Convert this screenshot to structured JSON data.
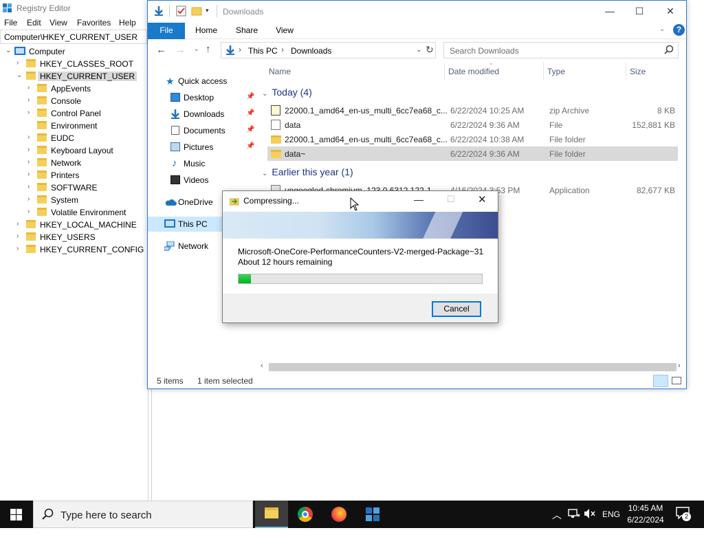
{
  "regedit": {
    "title": "Registry Editor",
    "menu": [
      "File",
      "Edit",
      "View",
      "Favorites",
      "Help"
    ],
    "address": "Computer\\HKEY_CURRENT_USER",
    "tree": [
      {
        "label": "Computer",
        "level": 0,
        "expanded": true,
        "icon": "pc-icon"
      },
      {
        "label": "HKEY_CLASSES_ROOT",
        "level": 1,
        "expanded": false
      },
      {
        "label": "HKEY_CURRENT_USER",
        "level": 1,
        "expanded": true,
        "selected": true
      },
      {
        "label": "AppEvents",
        "level": 2,
        "expanded": false
      },
      {
        "label": "Console",
        "level": 2,
        "expanded": false
      },
      {
        "label": "Control Panel",
        "level": 2,
        "expanded": false
      },
      {
        "label": "Environment",
        "level": 2,
        "leaf": true
      },
      {
        "label": "EUDC",
        "level": 2,
        "expanded": false
      },
      {
        "label": "Keyboard Layout",
        "level": 2,
        "expanded": false
      },
      {
        "label": "Network",
        "level": 2,
        "expanded": false
      },
      {
        "label": "Printers",
        "level": 2,
        "expanded": false
      },
      {
        "label": "SOFTWARE",
        "level": 2,
        "expanded": false
      },
      {
        "label": "System",
        "level": 2,
        "expanded": false
      },
      {
        "label": "Volatile Environment",
        "level": 2,
        "expanded": false
      },
      {
        "label": "HKEY_LOCAL_MACHINE",
        "level": 1,
        "expanded": false
      },
      {
        "label": "HKEY_USERS",
        "level": 1,
        "expanded": false
      },
      {
        "label": "HKEY_CURRENT_CONFIG",
        "level": 1,
        "expanded": false
      }
    ]
  },
  "explorer": {
    "title": "Downloads",
    "ribbon_tabs": [
      "File",
      "Home",
      "Share",
      "View"
    ],
    "breadcrumb": [
      "This PC",
      "Downloads"
    ],
    "search_placeholder": "Search Downloads",
    "nav": [
      {
        "label": "Quick access",
        "icon": "star-icon",
        "pinned": false
      },
      {
        "label": "Desktop",
        "icon": "desktop-icon",
        "pinned": true
      },
      {
        "label": "Downloads",
        "icon": "download-icon",
        "pinned": true
      },
      {
        "label": "Documents",
        "icon": "documents-icon",
        "pinned": true
      },
      {
        "label": "Pictures",
        "icon": "pictures-icon",
        "pinned": true
      },
      {
        "label": "Music",
        "icon": "music-icon",
        "pinned": false
      },
      {
        "label": "Videos",
        "icon": "videos-icon",
        "pinned": false
      },
      {
        "label": "OneDrive",
        "icon": "onedrive-icon",
        "pinned": false
      },
      {
        "label": "This PC",
        "icon": "pc-icon",
        "pinned": false,
        "selected": true
      },
      {
        "label": "Network",
        "icon": "network-icon",
        "pinned": false
      }
    ],
    "columns": [
      "Name",
      "Date modified",
      "Type",
      "Size"
    ],
    "groups": [
      {
        "label": "Today (4)",
        "files": [
          {
            "name": "22000.1_amd64_en-us_multi_6cc7ea68_c...",
            "date": "6/22/2024 10:25 AM",
            "type": "zip Archive",
            "size": "8 KB",
            "icon": "zip"
          },
          {
            "name": "data",
            "date": "6/22/2024 9:36 AM",
            "type": "File",
            "size": "152,881 KB",
            "icon": "doc"
          },
          {
            "name": "22000.1_amd64_en-us_multi_6cc7ea68_c...",
            "date": "6/22/2024 10:38 AM",
            "type": "File folder",
            "size": "",
            "icon": "folder"
          },
          {
            "name": "data~",
            "date": "6/22/2024 9:36 AM",
            "type": "File folder",
            "size": "",
            "icon": "folder",
            "selected": true
          }
        ]
      },
      {
        "label": "Earlier this year (1)",
        "files": [
          {
            "name": "ungoogled-chromium_123.0.6312.122-1...",
            "date": "4/16/2024 3:53 PM",
            "type": "Application",
            "size": "82,677 KB",
            "icon": "app"
          }
        ]
      }
    ],
    "status_items": "5 items",
    "status_selected": "1 item selected"
  },
  "dialog": {
    "title": "Compressing...",
    "filename": "Microsoft-OneCore-PerformanceCounters-V2-merged-Package~31",
    "remaining": "About 12 hours remaining",
    "progress_fraction": 0.05,
    "cancel_label": "Cancel"
  },
  "taskbar": {
    "search_placeholder": "Type here to search",
    "language": "ENG",
    "time": "10:45 AM",
    "date": "6/22/2024",
    "notification_count": "2"
  }
}
